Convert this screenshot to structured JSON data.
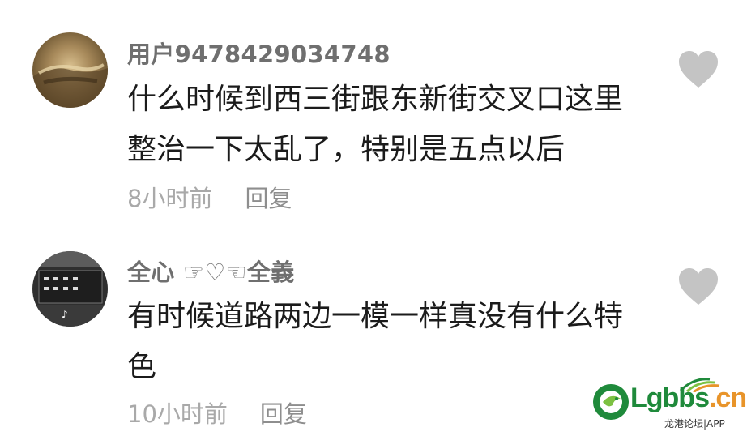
{
  "comments": [
    {
      "username": "用户9478429034748",
      "text": "什么时候到西三街跟东新街交叉口这里整治一下太乱了，特别是五点以后",
      "time": "8小时前",
      "reply_label": "回复"
    },
    {
      "username": "全心 ☞♡☜全義",
      "text": "有时候道路两边一模一样真没有什么特色",
      "time": "10小时前",
      "reply_label": "回复"
    }
  ],
  "watermark": {
    "brand_main": "Lgbbs",
    "brand_tld": ".cn",
    "subtitle": "龙港论坛|APP"
  },
  "colors": {
    "username": "#6f6f6f",
    "text": "#1b1b1b",
    "meta": "#a9a9a9",
    "like_icon": "#c4c4c4",
    "brand_green": "#1f8a3b",
    "brand_orange": "#e8942a"
  }
}
